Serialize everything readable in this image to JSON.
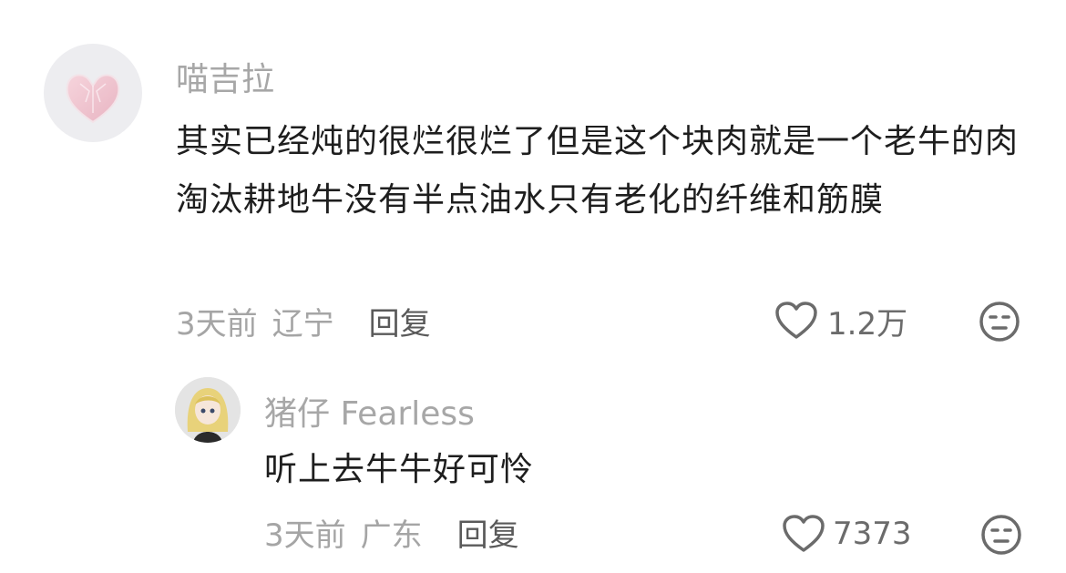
{
  "comments": [
    {
      "username": "喵吉拉",
      "avatar_icon": "pink-diamond-heart-avatar",
      "text": "其实已经炖的很烂很烂了但是这个块肉就是一个老牛的肉淘汰耕地牛没有半点油水只有老化的纤维和筋膜",
      "time": "3天前",
      "location": "辽宁",
      "reply_label": "回复",
      "likes": "1.2万"
    },
    {
      "username": "猪仔 Fearless",
      "avatar_icon": "anime-girl-avatar",
      "text": "听上去牛牛好可怜",
      "time": "3天前",
      "location": "广东",
      "reply_label": "回复",
      "likes": "7373"
    }
  ],
  "icons": {
    "like": "heart-outline-icon",
    "dislike": "unamused-face-icon"
  },
  "colors": {
    "username": "#a7a7a7",
    "body": "#1e1e1e",
    "meta": "#a5a5a5",
    "reply": "#5a5a5a",
    "icon": "#6b6b6b"
  }
}
